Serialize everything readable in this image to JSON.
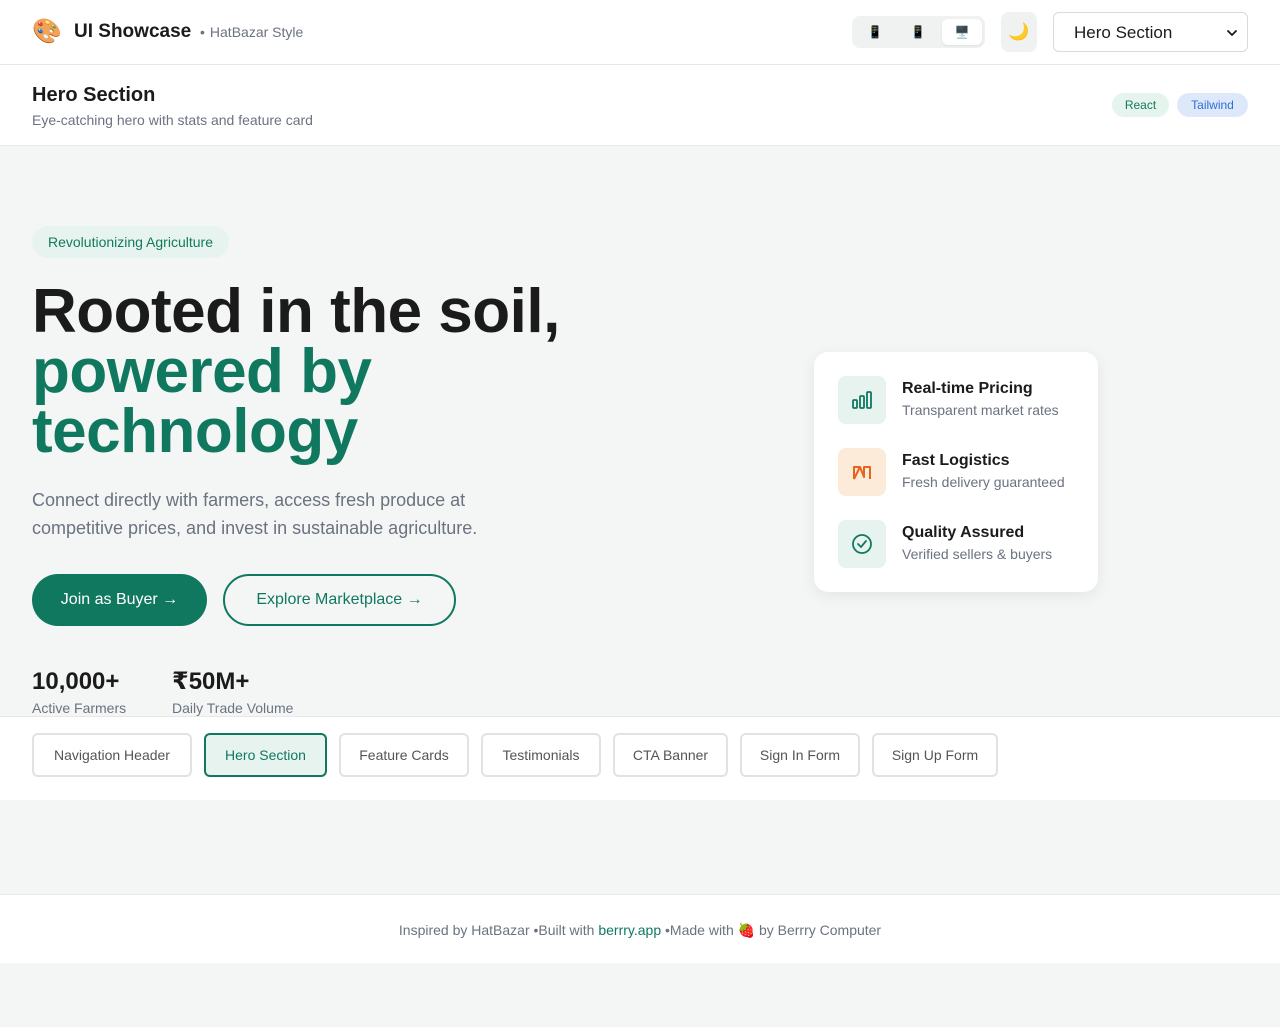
{
  "app": {
    "title": "UI Showcase",
    "subtitle": "HatBazar Style",
    "emoji": "🎨"
  },
  "toolbar": {
    "devices": [
      {
        "name": "mobile",
        "icon": "📱",
        "active": false
      },
      {
        "name": "tablet",
        "icon": "📱",
        "active": false
      },
      {
        "name": "desktop",
        "icon": "🖥️",
        "active": true
      }
    ],
    "theme_icon": "🌙",
    "section_select": {
      "value": "Hero Section",
      "options": [
        "Navigation Header",
        "Hero Section",
        "Feature Cards",
        "Testimonials",
        "CTA Banner",
        "Sign In Form",
        "Sign Up Form"
      ]
    }
  },
  "section_header": {
    "title": "Hero Section",
    "description": "Eye-catching hero with stats and feature card",
    "tags": [
      "React",
      "Tailwind"
    ]
  },
  "hero": {
    "pill": "Revolutionizing Agriculture",
    "title_line1": "Rooted in the soil,",
    "title_line2": "powered by",
    "title_line3": "technology",
    "subtitle": "Connect directly with farmers, access fresh produce at competitive prices, and invest in sustainable agriculture.",
    "primary_cta": "Join as Buyer  →",
    "secondary_cta": "Explore Marketplace  →",
    "stats": [
      {
        "value": "10,000+",
        "label": "Active Farmers"
      },
      {
        "value": "₹50M+",
        "label": "Daily Trade Volume"
      }
    ]
  },
  "features": [
    {
      "title": "Real-time Pricing",
      "description": "Transparent market rates",
      "icon": "bar-chart-icon",
      "color": "#117860",
      "bg": "#e7f3ee"
    },
    {
      "title": "Fast Logistics",
      "description": "Fresh delivery guaranteed",
      "icon": "truck-icon",
      "color": "#e8641a",
      "bg": "#fdebd9"
    },
    {
      "title": "Quality Assured",
      "description": "Verified sellers & buyers",
      "icon": "check-circle-icon",
      "color": "#117860",
      "bg": "#e7f3ee"
    }
  ],
  "tabs": [
    {
      "label": "Navigation Header",
      "active": false
    },
    {
      "label": "Hero Section",
      "active": true
    },
    {
      "label": "Feature Cards",
      "active": false
    },
    {
      "label": "Testimonials",
      "active": false
    },
    {
      "label": "CTA Banner",
      "active": false
    },
    {
      "label": "Sign In Form",
      "active": false
    },
    {
      "label": "Sign Up Form",
      "active": false
    }
  ],
  "footer": {
    "prefix": "Inspired by HatBazar",
    "built_with": "Built with",
    "link": "berrry.app",
    "made_with": "Made with",
    "emoji": "🍓",
    "suffix": "by Berrry Computer"
  },
  "colors": {
    "brand": "#117860",
    "brand_light": "#e7f3ee",
    "text": "#1b1b1b",
    "muted": "#6b7280"
  }
}
